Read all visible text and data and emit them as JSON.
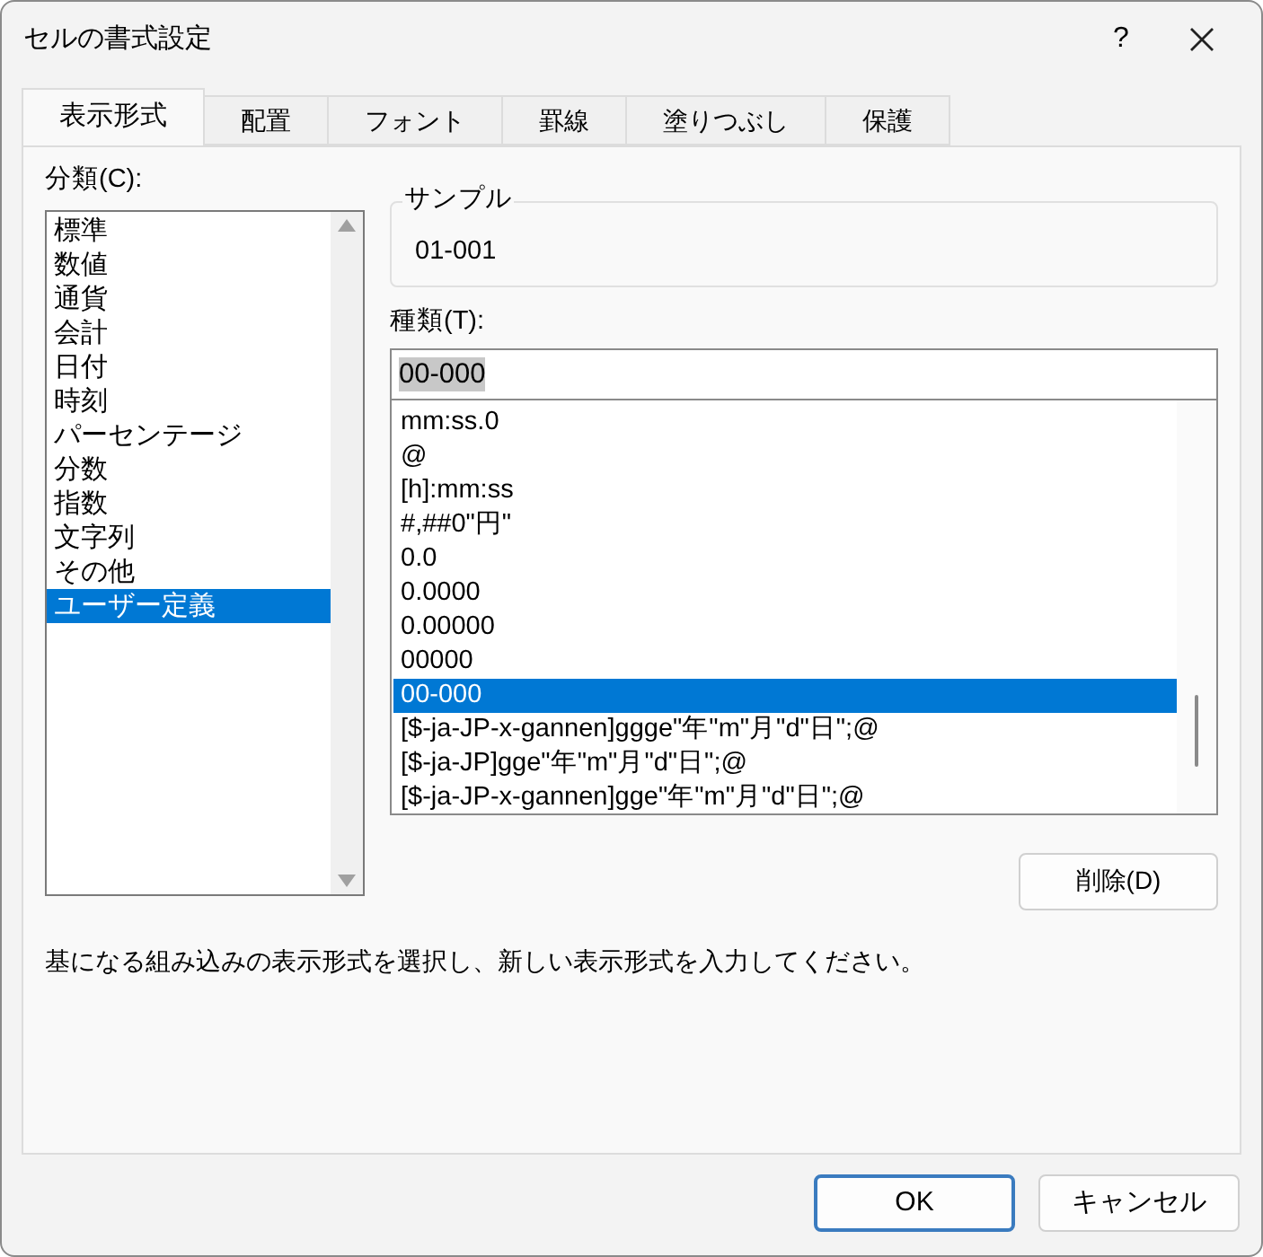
{
  "window": {
    "title": "セルの書式設定",
    "help": "?"
  },
  "tabs": [
    {
      "label": "表示形式",
      "selected": true
    },
    {
      "label": "配置",
      "selected": false
    },
    {
      "label": "フォント",
      "selected": false
    },
    {
      "label": "罫線",
      "selected": false
    },
    {
      "label": "塗りつぶし",
      "selected": false
    },
    {
      "label": "保護",
      "selected": false
    }
  ],
  "category": {
    "label": "分類(C):",
    "items": [
      {
        "label": "標準",
        "selected": false
      },
      {
        "label": "数値",
        "selected": false
      },
      {
        "label": "通貨",
        "selected": false
      },
      {
        "label": "会計",
        "selected": false
      },
      {
        "label": "日付",
        "selected": false
      },
      {
        "label": "時刻",
        "selected": false
      },
      {
        "label": "パーセンテージ",
        "selected": false
      },
      {
        "label": "分数",
        "selected": false
      },
      {
        "label": "指数",
        "selected": false
      },
      {
        "label": "文字列",
        "selected": false
      },
      {
        "label": "その他",
        "selected": false
      },
      {
        "label": "ユーザー定義",
        "selected": true
      }
    ]
  },
  "sample": {
    "label": "サンプル",
    "value": "01-001"
  },
  "type": {
    "label": "種類(T):",
    "value": "00-000",
    "items": [
      {
        "label": "mm:ss.0",
        "selected": false
      },
      {
        "label": "@",
        "selected": false
      },
      {
        "label": "[h]:mm:ss",
        "selected": false
      },
      {
        "label": "#,##0\"円\"",
        "selected": false
      },
      {
        "label": "0.0",
        "selected": false
      },
      {
        "label": "0.0000",
        "selected": false
      },
      {
        "label": "0.00000",
        "selected": false
      },
      {
        "label": "00000",
        "selected": false
      },
      {
        "label": "00-000",
        "selected": true
      },
      {
        "label": "[$-ja-JP-x-gannen]ggge\"年\"m\"月\"d\"日\";@",
        "selected": false
      },
      {
        "label": "[$-ja-JP]gge\"年\"m\"月\"d\"日\";@",
        "selected": false
      },
      {
        "label": "[$-ja-JP-x-gannen]gge\"年\"m\"月\"d\"日\";@",
        "selected": false
      }
    ]
  },
  "delete_button": "削除(D)",
  "description": "基になる組み込みの表示形式を選択し、新しい表示形式を入力してください。",
  "buttons": [
    {
      "label": "OK",
      "kind": "primary"
    },
    {
      "label": "キャンセル",
      "kind": "secondary"
    }
  ]
}
